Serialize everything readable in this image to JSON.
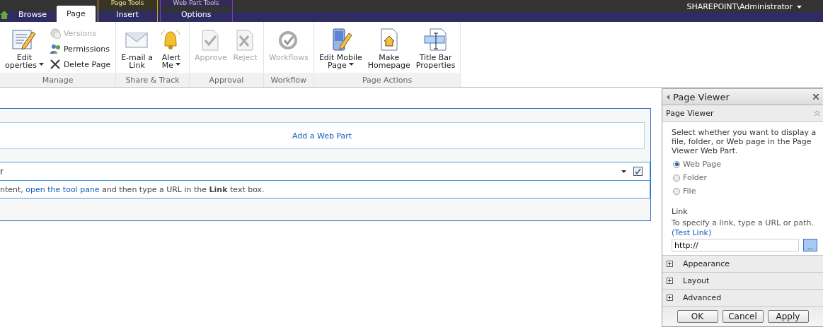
{
  "top_bar": {
    "context_groups": [
      {
        "label": "Page Tools",
        "tabs": [
          {
            "label": "Insert",
            "selected": false
          }
        ]
      },
      {
        "label": "Web Part Tools",
        "tabs": [
          {
            "label": "Options",
            "selected": false
          }
        ]
      }
    ],
    "tabs": [
      {
        "label": "Browse",
        "selected": false
      },
      {
        "label": "Page",
        "selected": true
      }
    ],
    "user": "SHAREPOINT\\Administrator"
  },
  "ribbon": {
    "groups": [
      {
        "label": "Manage",
        "buttons": [
          {
            "kind": "large",
            "lines": [
              "Edit",
              "operties"
            ],
            "dropdown": true,
            "disabled": false
          },
          {
            "kind": "small",
            "lines": [
              "Versions"
            ],
            "dropdown": false,
            "disabled": true
          },
          {
            "kind": "small",
            "lines": [
              "Permissions"
            ],
            "dropdown": false,
            "disabled": false
          },
          {
            "kind": "small",
            "lines": [
              "Delete Page"
            ],
            "dropdown": false,
            "disabled": false
          }
        ]
      },
      {
        "label": "Share & Track",
        "buttons": [
          {
            "kind": "large",
            "lines": [
              "E-mail a",
              "Link"
            ],
            "dropdown": false,
            "disabled": false
          },
          {
            "kind": "large",
            "lines": [
              "Alert",
              "Me"
            ],
            "dropdown": true,
            "disabled": false
          }
        ]
      },
      {
        "label": "Approval",
        "buttons": [
          {
            "kind": "large",
            "lines": [
              "Approve"
            ],
            "dropdown": false,
            "disabled": true
          },
          {
            "kind": "large",
            "lines": [
              "Reject"
            ],
            "dropdown": false,
            "disabled": true
          }
        ]
      },
      {
        "label": "Workflow",
        "buttons": [
          {
            "kind": "large",
            "lines": [
              "Workflows"
            ],
            "dropdown": false,
            "disabled": true
          }
        ]
      },
      {
        "label": "Page Actions",
        "buttons": [
          {
            "kind": "large",
            "lines": [
              "Edit Mobile",
              "Page"
            ],
            "dropdown": true,
            "disabled": false
          },
          {
            "kind": "large",
            "lines": [
              "Make",
              "Homepage"
            ],
            "dropdown": false,
            "disabled": false
          },
          {
            "kind": "large",
            "lines": [
              "Title Bar",
              "Properties"
            ],
            "dropdown": false,
            "disabled": false
          }
        ]
      }
    ]
  },
  "zone": {
    "add_web_part": "Add a Web Part",
    "web_part": {
      "title": "r",
      "checked": true,
      "text_before": "ntent, ",
      "link": "open the tool pane",
      "text_after": " and then type a URL in the **Link** text box."
    }
  },
  "tool_pane": {
    "title": "Page Viewer",
    "sections": [
      {
        "label": "Page Viewer",
        "expanded": true
      },
      {
        "label": "Appearance",
        "expanded": false
      },
      {
        "label": "Layout",
        "expanded": false
      },
      {
        "label": "Advanced",
        "expanded": false
      }
    ],
    "description": "Select whether you want to display a file, folder, or Web page in the Page Viewer Web Part.",
    "options": [
      {
        "label": "Web Page",
        "selected": true
      },
      {
        "label": "Folder",
        "selected": false
      },
      {
        "label": "File",
        "selected": false
      }
    ],
    "link_label": "Link",
    "help": "To specify a link, type a URL or path.",
    "help_link": "(Test Link)",
    "link_value": "http://",
    "browse_button": "...",
    "buttons": [
      "OK",
      "Cancel",
      "Apply"
    ]
  }
}
